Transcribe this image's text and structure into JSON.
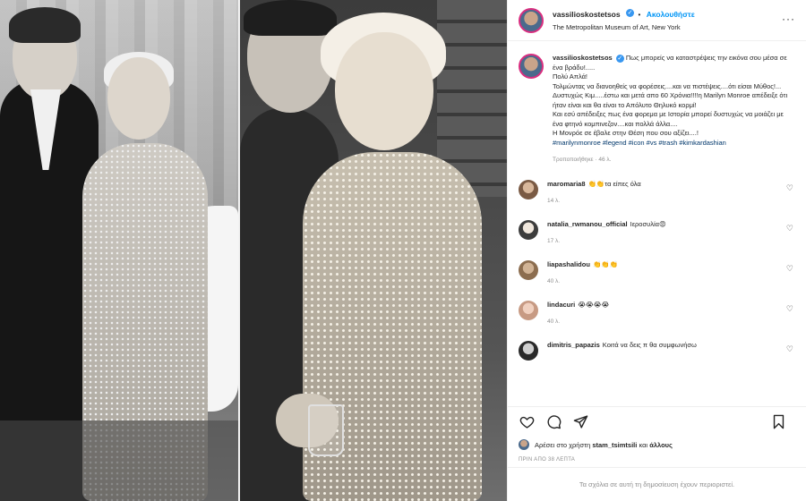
{
  "post": {
    "username": "vassilioskostetsos",
    "follow_label": "Ακολουθήστε",
    "location": "The Metropolitan Museum of Art, New York",
    "more_label": "···",
    "caption": {
      "username": "vassilioskostetsos",
      "lines": [
        "Πως μπορείς να καταστρέψεις την εικόνα σου μέσα σε ένα βράδυ!.....",
        "Πολύ Απλά!",
        "Τολμώντας να διανοηθείς να φορέσεις....και να πιστέψεις....ότι είσαι Μύθος!...",
        "Δυστυχώς Κιμ.....έστω και μετά απο 60 Χρόνια!!!!η Marilyn Monroe απέδειξε ότι ήταν είναι και θα είναι το Απόλυτο Θηλυκό κορμί!",
        "Και εσύ απέδειξες πως ένα φορεμα με Ιστορία μπορεί δυστυχώς να μοιάζει με ένα φτηνό κομπινεζον....και πολλά άλλα....",
        "Η Μονρόε σε έβαλε στην Θέση που σου αξίζει....!"
      ],
      "hashtags": "#marilynmonroe #legend #icon #vs #trash #kimkardashian",
      "edited": "Τροποποιήθηκε · 46 λ."
    },
    "comments": [
      {
        "user": "maromaria8",
        "text": "👏👏τα είπες όλα",
        "time": "14 λ."
      },
      {
        "user": "natalia_rwmanou_official",
        "text": "Ιεροσυλία😡",
        "time": "17 λ."
      },
      {
        "user": "liapashalidou",
        "text": "👏👏👏",
        "time": "40 λ."
      },
      {
        "user": "lindacuri",
        "text": "😭😭😭😭",
        "time": "40 λ."
      },
      {
        "user": "dimitris_papazis",
        "text": "Κοιτά να δεις π θα συμφωνήσω",
        "time": ""
      }
    ],
    "likes": {
      "prefix": "Αρέσει στο χρήστη",
      "user": "stam_tsimtsili",
      "conj": "και",
      "others": "άλλους"
    },
    "posted_ago": "ΠΡΙΝ ΑΠΟ 38 ΛΕΠΤΑ",
    "restricted_text": "Τα σχόλια σε αυτή τη δημοσίευση έχουν περιοριστεί.",
    "icons": [
      "heart-icon",
      "comment-icon",
      "share-icon",
      "bookmark-icon",
      "verified-icon"
    ],
    "colors": {
      "accent": "#0095f6",
      "verified": "#3897f0",
      "hashtag": "#00376b",
      "muted": "#8e8e8e"
    }
  }
}
